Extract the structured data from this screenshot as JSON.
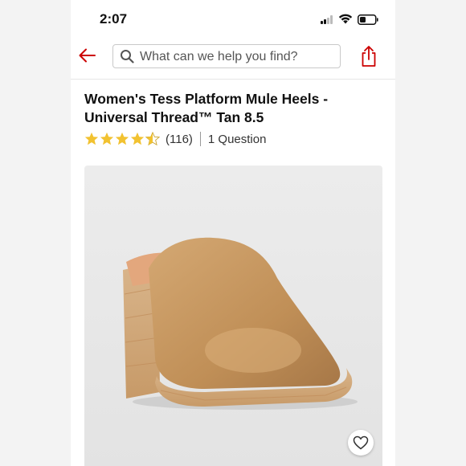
{
  "status_bar": {
    "time": "2:07"
  },
  "search": {
    "placeholder": "What can we help you find?"
  },
  "product": {
    "title": "Women's Tess Platform Mule Heels - Universal Thread™ Tan 8.5",
    "rating": 4.5,
    "review_count": "(116)",
    "questions": "1 Question"
  },
  "colors": {
    "accent": "#cc0000",
    "star": "#f2c230",
    "shoe": "#c69a63"
  },
  "icons": [
    "back-arrow-icon",
    "search-icon",
    "share-icon",
    "star-icon",
    "heart-icon"
  ]
}
